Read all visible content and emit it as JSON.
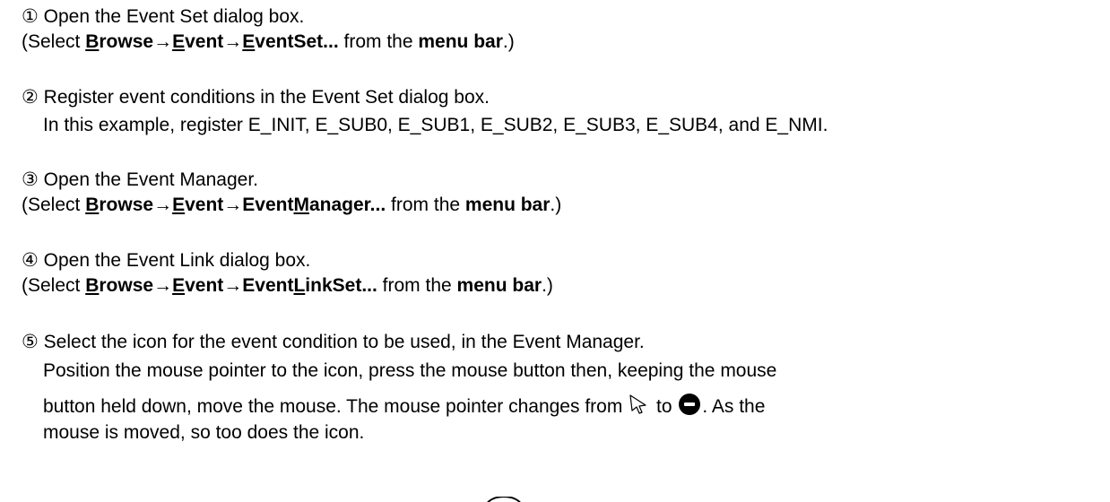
{
  "steps": [
    {
      "marker": "①",
      "text": " Open the Event Set dialog box.",
      "select_prefix": "(Select ",
      "menu": {
        "b1": "B",
        "b2": "rowse",
        "arrow1": "→",
        "e1": "E",
        "e2": "vent",
        "arrow2": "→",
        "s1": "E",
        "s2": "ventSet..."
      },
      "select_mid": " from the ",
      "select_menubar": "menu bar",
      "select_suffix": ".)"
    },
    {
      "marker": "②",
      "text": " Register event conditions in the Event Set dialog box.",
      "detail": "In this example, register E_INIT, E_SUB0, E_SUB1, E_SUB2, E_SUB3, E_SUB4, and E_NMI."
    },
    {
      "marker": "③",
      "text": " Open the Event Manager.",
      "select_prefix": "(Select ",
      "menu": {
        "b1": "B",
        "b2": "rowse",
        "arrow1": "→",
        "e1": "E",
        "e2": "vent",
        "arrow2": "→",
        "s1": "Event",
        "s2": "M",
        "s3": "anager..."
      },
      "select_mid": " from the ",
      "select_menubar": "menu bar",
      "select_suffix": ".)"
    },
    {
      "marker": "④",
      "text": " Open the Event Link dialog box.",
      "select_prefix": "(Select ",
      "menu": {
        "b1": "B",
        "b2": "rowse",
        "arrow1": "→",
        "e1": "E",
        "e2": "vent",
        "arrow2": "→",
        "s1": "Event",
        "s2": "L",
        "s3": "inkSet..."
      },
      "select_mid": " from the ",
      "select_menubar": "menu bar",
      "select_suffix": ".)"
    },
    {
      "marker": "⑤",
      "text": " Select the icon for the event condition to be used, in the Event Manager.",
      "p1": "Position the mouse pointer to the icon, press the mouse button then, keeping the mouse",
      "p2a": "button held down, move the mouse.  The mouse pointer changes from ",
      "p2b": " to ",
      "p2c": ".  As the",
      "p3": "mouse is moved, so too does the icon."
    }
  ],
  "icons": [
    "arrow-pointer-icon",
    "no-entry-pointer-icon"
  ]
}
